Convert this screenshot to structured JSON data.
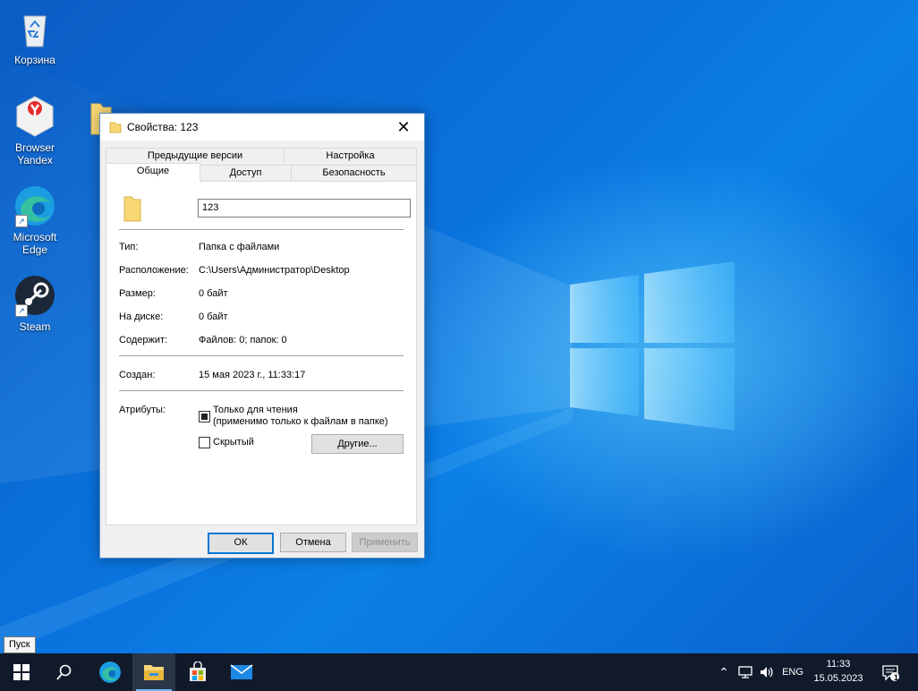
{
  "desktop": {
    "icons": [
      {
        "label": "Корзина"
      },
      {
        "label": "Browser Yandex"
      },
      {
        "label": "Microsoft Edge"
      },
      {
        "label": "Steam"
      }
    ]
  },
  "dialog": {
    "title": "Свойства: 123",
    "tabs": {
      "prev_versions": "Предыдущие версии",
      "settings": "Настройка",
      "general": "Общие",
      "access": "Доступ",
      "security": "Безопасность"
    },
    "name_value": "123",
    "fields": {
      "type_label": "Тип:",
      "type_value": "Папка с файлами",
      "location_label": "Расположение:",
      "location_value": "C:\\Users\\Администратор\\Desktop",
      "size_label": "Размер:",
      "size_value": "0 байт",
      "disk_label": "На диске:",
      "disk_value": "0 байт",
      "contains_label": "Содержит:",
      "contains_value": "Файлов: 0; папок: 0",
      "created_label": "Создан:",
      "created_value": "15 мая 2023 г., 11:33:17",
      "attributes_label": "Атрибуты:"
    },
    "readonly_line1": "Только для чтения",
    "readonly_line2": "(применимо только к файлам в папке)",
    "hidden_label": "Скрытый",
    "other_button": "Другие...",
    "ok_button": "ОК",
    "cancel_button": "Отмена",
    "apply_button": "Применить"
  },
  "tooltip": "Пуск",
  "taskbar": {
    "language": "ENG",
    "time": "11:33",
    "date": "15.05.2023",
    "notification_count": "1"
  },
  "colors": {
    "accent": "#0078d7",
    "taskbar": "#101a2b",
    "folder": "#f8d775"
  }
}
